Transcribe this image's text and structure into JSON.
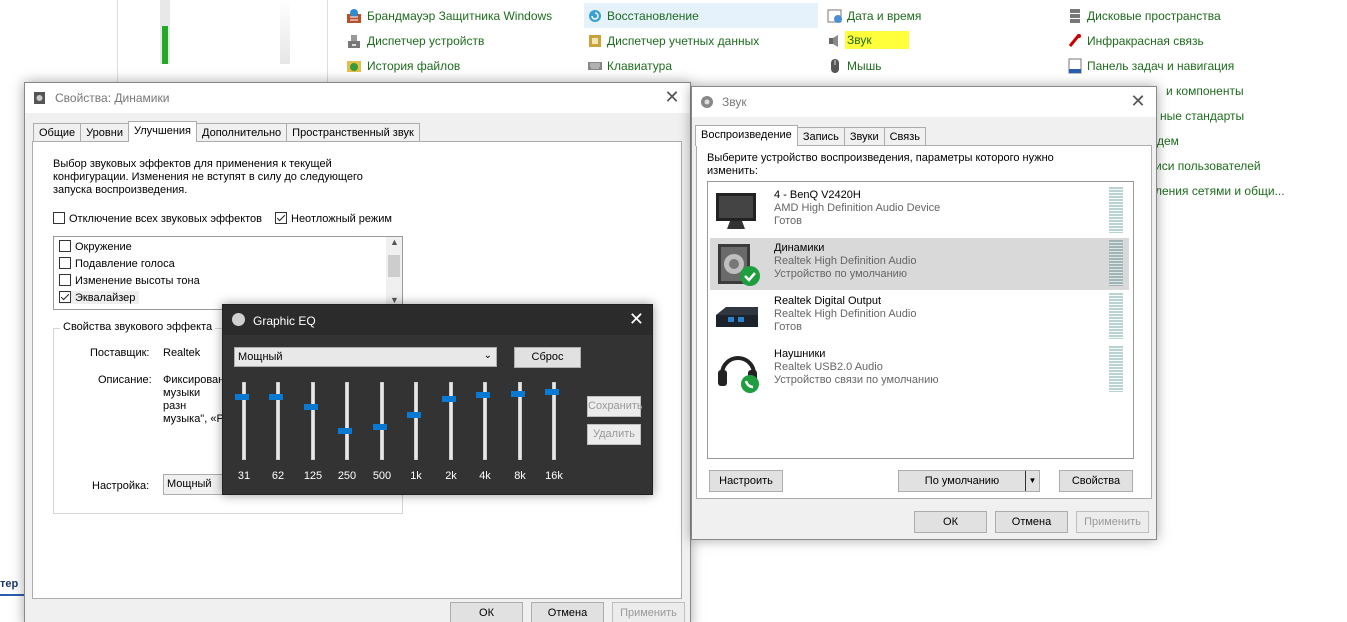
{
  "control_panel": {
    "col1": [
      "Брандмауэр Защитника Windows",
      "Диспетчер устройств",
      "История файлов"
    ],
    "col2": [
      "Восстановление",
      "Диспетчер учетных данных",
      "Клавиатура"
    ],
    "col3": [
      "Дата и время",
      "Звук",
      "Мышь"
    ],
    "col4": [
      "Дисковые пространства",
      "Инфракрасная связь",
      "Панель задач и навигация",
      "и компоненты",
      "ные стандарты",
      "дем",
      "иси пользователей",
      "ления сетями и общи..."
    ],
    "left_edge_text": "тер"
  },
  "props": {
    "title": "Свойства: Динамики",
    "tabs": [
      "Общие",
      "Уровни",
      "Улучшения",
      "Дополнительно",
      "Пространственный звук"
    ],
    "intro": "Выбор звуковых эффектов для применения к текущей конфигурации. Изменения не вступят в силу до следующего запуска воспроизведения.",
    "disable_all": "Отключение всех звуковых эффектов",
    "immediate": "Неотложный режим",
    "effects": [
      {
        "label": "Окружение",
        "checked": false
      },
      {
        "label": "Подавление голоса",
        "checked": false
      },
      {
        "label": "Изменение высоты тона",
        "checked": false
      },
      {
        "label": "Эквалайзер",
        "checked": true
      }
    ],
    "group_title": "Свойства звукового эффекта",
    "provider_label": "Поставщик:",
    "provider_value": "Realtek",
    "desc_label": "Описание:",
    "desc_value": "Фиксирован музыки разн музыка\", «Р",
    "setting_label": "Настройка:",
    "setting_value": "Мощный",
    "ok": "ОК",
    "cancel": "Отмена",
    "apply": "Применить"
  },
  "eq": {
    "title": "Graphic EQ",
    "preset": "Мощный",
    "reset": "Сброс",
    "save": "Сохранить",
    "delete": "Удалить",
    "bands": [
      {
        "label": "31",
        "level": 0.84
      },
      {
        "label": "62",
        "level": 0.84
      },
      {
        "label": "125",
        "level": 0.7
      },
      {
        "label": "250",
        "level": 0.36
      },
      {
        "label": "500",
        "level": 0.42
      },
      {
        "label": "1k",
        "level": 0.58
      },
      {
        "label": "2k",
        "level": 0.8
      },
      {
        "label": "4k",
        "level": 0.86
      },
      {
        "label": "8k",
        "level": 0.88
      },
      {
        "label": "16k",
        "level": 0.9
      }
    ]
  },
  "sound": {
    "title": "Звук",
    "tabs": [
      "Воспроизведение",
      "Запись",
      "Звуки",
      "Связь"
    ],
    "intro": "Выберите устройство воспроизведения, параметры которого нужно изменить:",
    "devices": [
      {
        "name": "4 - BenQ V2420H",
        "driver": "AMD High Definition Audio Device",
        "status": "Готов",
        "icon": "monitor-icon"
      },
      {
        "name": "Динамики",
        "driver": "Realtek High Definition Audio",
        "status": "Устройство по умолчанию",
        "icon": "speaker-icon"
      },
      {
        "name": "Realtek Digital Output",
        "driver": "Realtek High Definition Audio",
        "status": "Готов",
        "icon": "digital-output-icon"
      },
      {
        "name": "Наушники",
        "driver": "Realtek USB2.0 Audio",
        "status": "Устройство связи по умолчанию",
        "icon": "headphones-icon"
      }
    ],
    "configure": "Настроить",
    "set_default": "По умолчанию",
    "properties": "Свойства",
    "ok": "ОК",
    "cancel": "Отмена",
    "apply": "Применить"
  },
  "colors": {
    "link": "#1e6b1e",
    "highlight": "#ffff3c",
    "accent": "#0a79d2",
    "eq_bg": "#333333"
  }
}
